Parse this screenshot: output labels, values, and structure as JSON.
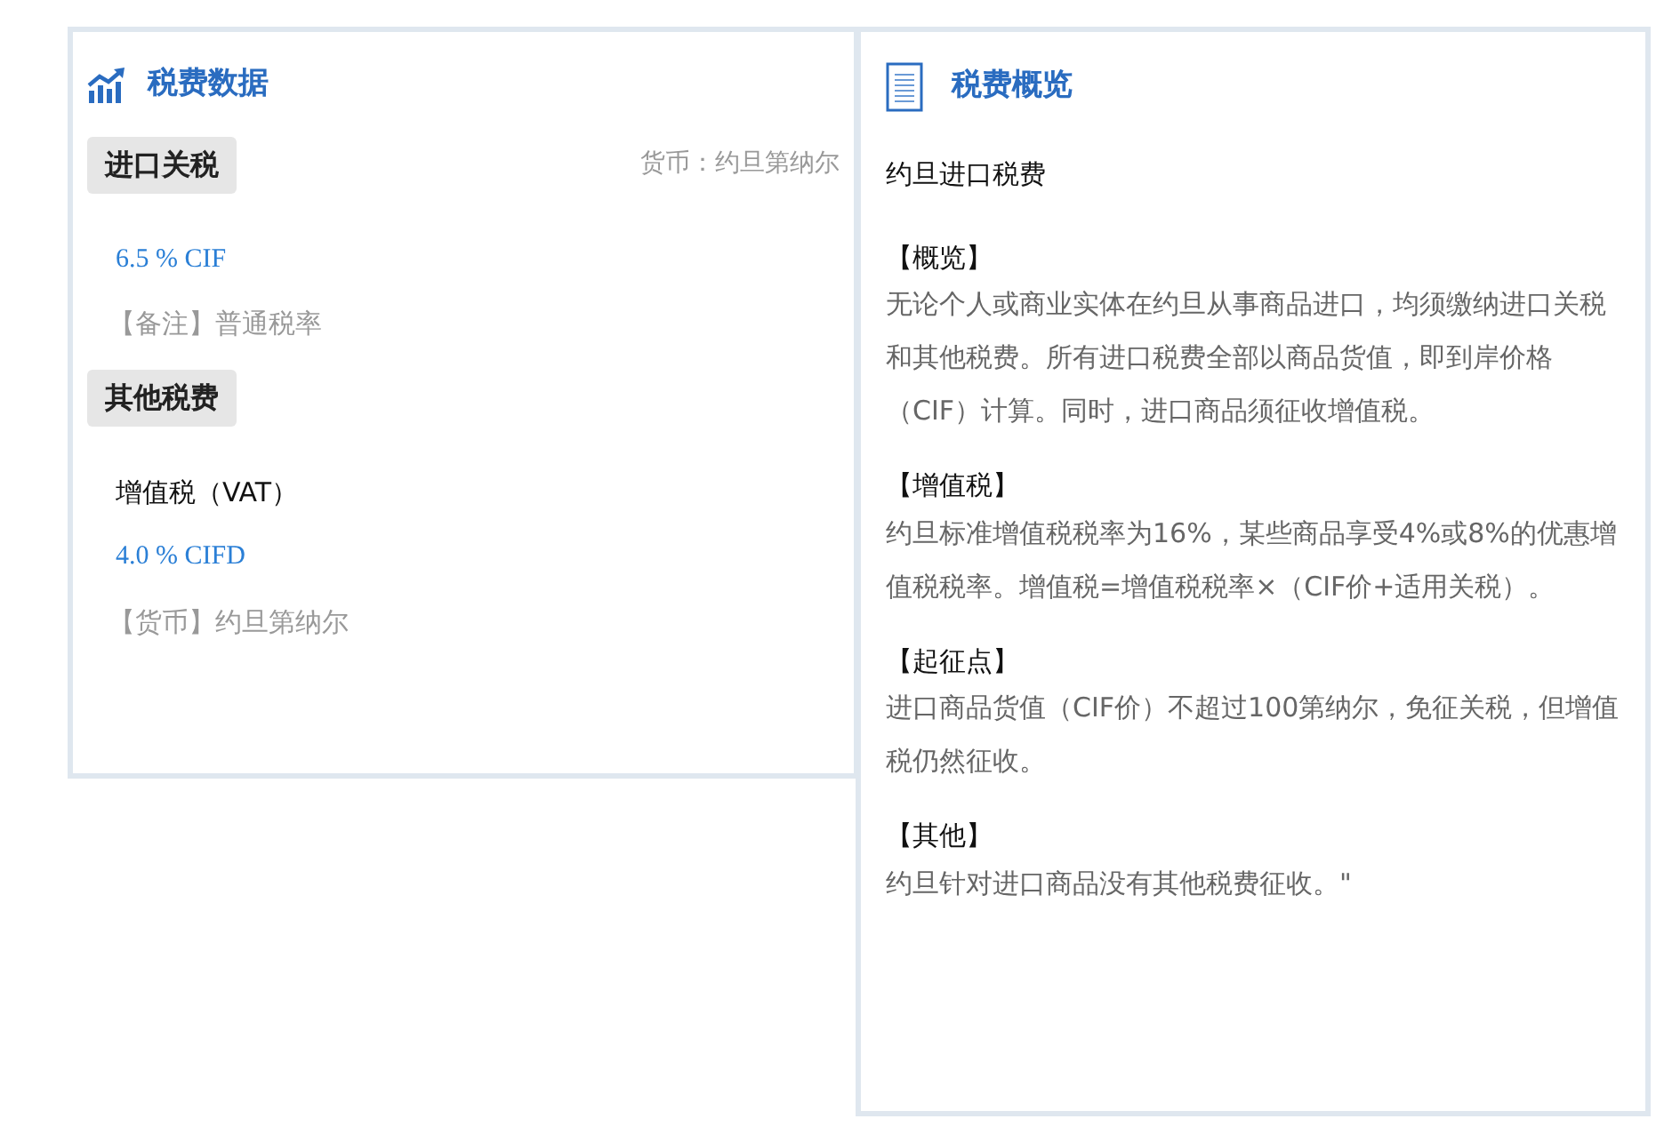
{
  "tax_data": {
    "title": "税费数据",
    "sections": [
      {
        "heading": "进口关税",
        "currency": "货币：约旦第纳尔",
        "lines": [
          {
            "kind": "rate",
            "text": "6.5 % CIF"
          },
          {
            "kind": "remark",
            "text": "【备注】普通税率"
          }
        ]
      },
      {
        "heading": "其他税费",
        "lines": [
          {
            "kind": "name",
            "text": "增值税（VAT）"
          },
          {
            "kind": "rate",
            "text": "4.0 % CIFD"
          },
          {
            "kind": "remark",
            "text": "【货币】约旦第纳尔"
          }
        ]
      }
    ]
  },
  "overview": {
    "title": "税费概览",
    "subtitle": "约旦进口税费",
    "blocks": [
      {
        "heading": "【概览】",
        "body": "无论个人或商业实体在约旦从事商品进口，均须缴纳进口关税和其他税费。所有进口税费全部以商品货值，即到岸价格（CIF）计算。同时，进口商品须征收增值税。"
      },
      {
        "heading": "【增值税】",
        "body": "约旦标准增值税税率为16%，某些商品享受4%或8%的优惠增值税税率。增值税=增值税税率×（CIF价+适用关税）。"
      },
      {
        "heading": "【起征点】",
        "body": "进口商品货值（CIF价）不超过100第纳尔，免征关税，但增值税仍然征收。"
      },
      {
        "heading": "【其他】",
        "body": "约旦针对进口商品没有其他税费征收。\""
      }
    ]
  }
}
